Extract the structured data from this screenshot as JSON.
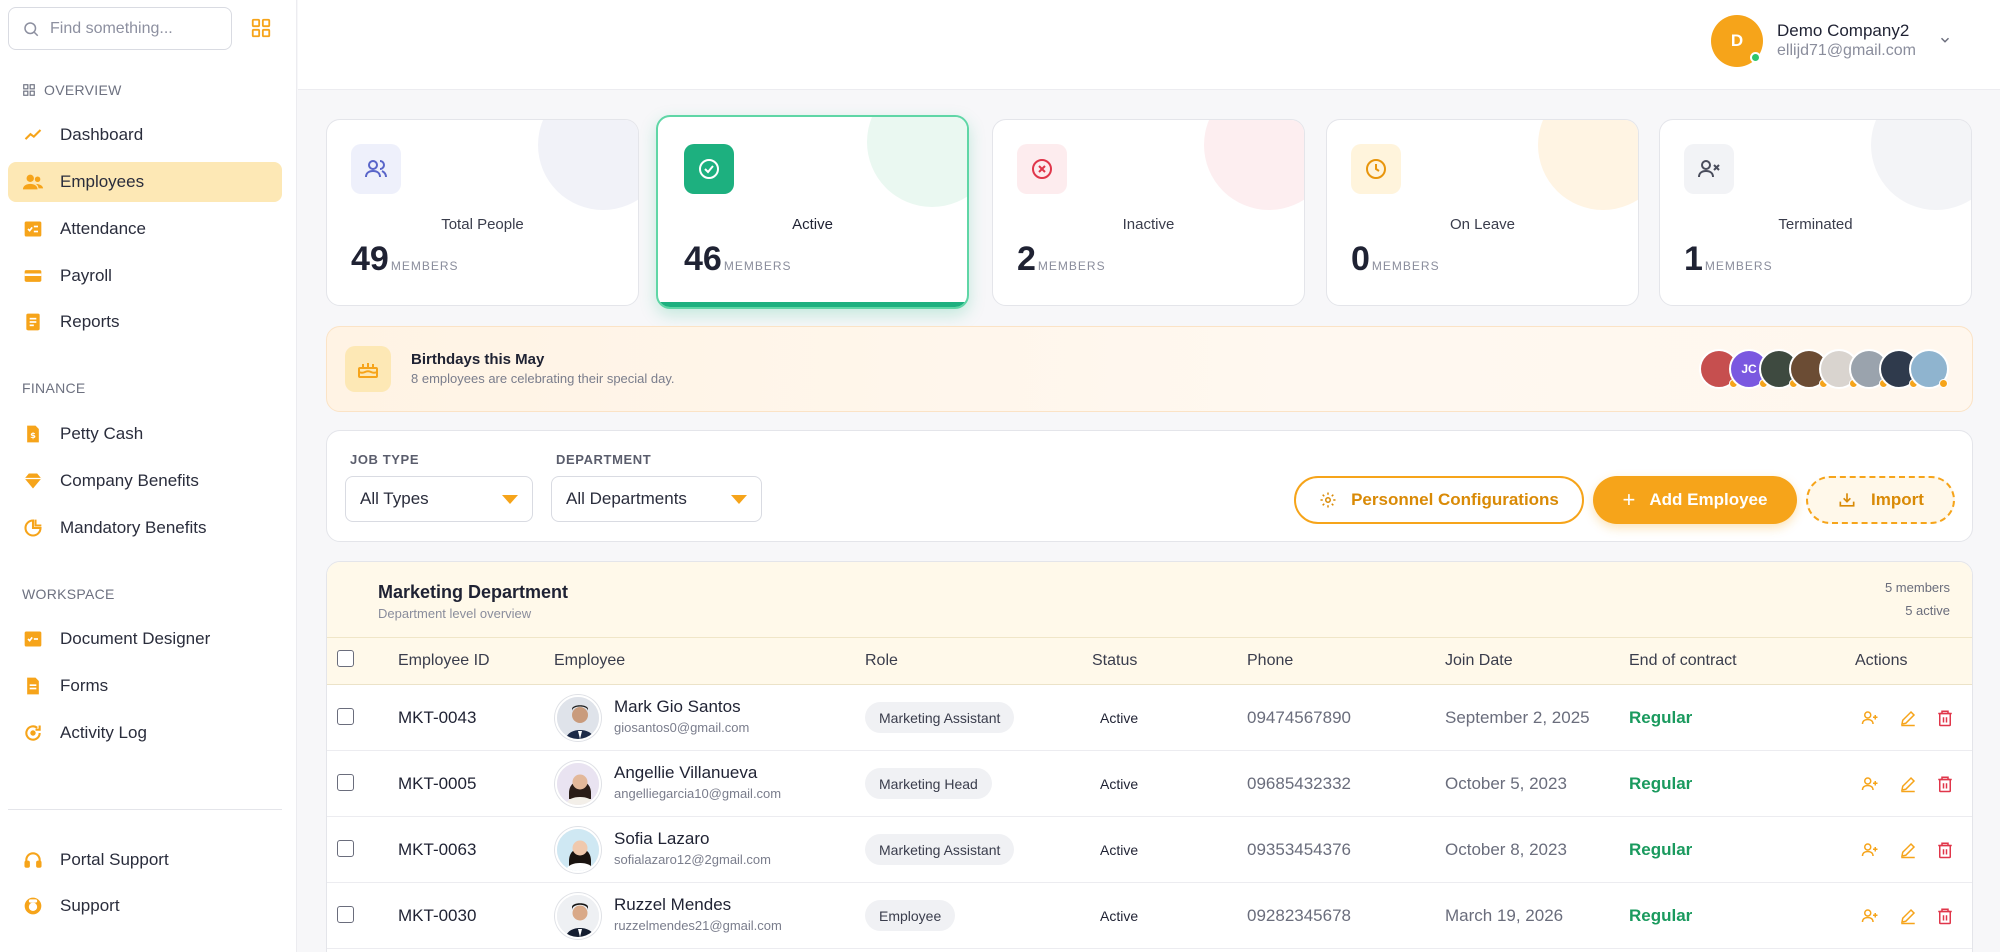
{
  "sidebar": {
    "search_placeholder": "Find something...",
    "sections": [
      {
        "label": "OVERVIEW"
      },
      {
        "label": "FINANCE"
      },
      {
        "label": "WORKSPACE"
      }
    ],
    "items": [
      {
        "label": "Dashboard",
        "icon": "trend-icon"
      },
      {
        "label": "Employees",
        "icon": "users-icon"
      },
      {
        "label": "Attendance",
        "icon": "attendance-icon"
      },
      {
        "label": "Payroll",
        "icon": "card-icon"
      },
      {
        "label": "Reports",
        "icon": "report-icon"
      },
      {
        "label": "Petty Cash",
        "icon": "cash-icon"
      },
      {
        "label": "Company Benefits",
        "icon": "diamond-icon"
      },
      {
        "label": "Mandatory Benefits",
        "icon": "pie-icon"
      },
      {
        "label": "Document Designer",
        "icon": "designer-icon"
      },
      {
        "label": "Forms",
        "icon": "forms-icon"
      },
      {
        "label": "Activity Log",
        "icon": "activity-icon"
      },
      {
        "label": "Portal Support",
        "icon": "headset-icon"
      },
      {
        "label": "Support",
        "icon": "support-icon"
      }
    ]
  },
  "user": {
    "initial": "D",
    "name": "Demo Company2",
    "email": "ellijd71@gmail.com"
  },
  "stats": [
    {
      "label": "Total People",
      "value": "49",
      "unit": "MEMBERS"
    },
    {
      "label": "Active",
      "value": "46",
      "unit": "MEMBERS"
    },
    {
      "label": "Inactive",
      "value": "2",
      "unit": "MEMBERS"
    },
    {
      "label": "On Leave",
      "value": "0",
      "unit": "MEMBERS"
    },
    {
      "label": "Terminated",
      "value": "1",
      "unit": "MEMBERS"
    }
  ],
  "birthdays": {
    "title": "Birthdays this May",
    "subtitle": "8 employees are celebrating their special day.",
    "avatar_initials": "JC"
  },
  "filters": {
    "job_type_label": "JOB TYPE",
    "job_type_value": "All Types",
    "department_label": "DEPARTMENT",
    "department_value": "All Departments",
    "personnel_button": "Personnel Configurations",
    "add_button": "Add Employee",
    "import_button": "Import"
  },
  "department": {
    "title": "Marketing Department",
    "subtitle": "Department level overview",
    "members": "5 members",
    "active": "5 active"
  },
  "table": {
    "headers": [
      "Employee ID",
      "Employee",
      "Role",
      "Status",
      "Phone",
      "Join Date",
      "End of contract",
      "Actions"
    ],
    "rows": [
      {
        "id": "MKT-0043",
        "name": "Mark Gio Santos",
        "email": "giosantos0@gmail.com",
        "role": "Marketing Assistant",
        "status": "Active",
        "phone": "09474567890",
        "join": "September 2, 2025",
        "eoc": "Regular"
      },
      {
        "id": "MKT-0005",
        "name": "Angellie Villanueva",
        "email": "angelliegarcia10@gmail.com",
        "role": "Marketing Head",
        "status": "Active",
        "phone": "09685432332",
        "join": "October 5, 2023",
        "eoc": "Regular"
      },
      {
        "id": "MKT-0063",
        "name": "Sofia Lazaro",
        "email": "sofialazaro12@2gmail.com",
        "role": "Marketing Assistant",
        "status": "Active",
        "phone": "09353454376",
        "join": "October 8, 2023",
        "eoc": "Regular"
      },
      {
        "id": "MKT-0030",
        "name": "Ruzzel Mendes",
        "email": "ruzzelmendes21@gmail.com",
        "role": "Employee",
        "status": "Active",
        "phone": "09282345678",
        "join": "March 19, 2026",
        "eoc": "Regular"
      }
    ]
  },
  "colors": {
    "accent": "#f6a41a",
    "active_green": "#1db07f",
    "danger": "#e0364a"
  }
}
